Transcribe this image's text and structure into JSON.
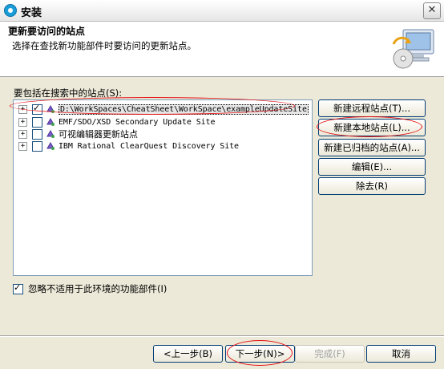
{
  "window": {
    "title": "安装"
  },
  "banner": {
    "title": "更新要访问的站点",
    "description": "选择在查找新功能部件时要访问的更新站点。"
  },
  "site_list": {
    "label": "要包括在搜索中的站点(S):",
    "items": [
      {
        "label": "D:\\WorkSpaces\\CheatSheet\\WorkSpace\\exampleUpdateSite",
        "checked": true
      },
      {
        "label": "EMF/SDO/XSD Secondary Update Site",
        "checked": false
      },
      {
        "label": "可视编辑器更新站点",
        "checked": false
      },
      {
        "label": "IBM Rational ClearQuest Discovery Site",
        "checked": false
      }
    ]
  },
  "side_buttons": {
    "new_remote": "新建远程站点(T)...",
    "new_local": "新建本地站点(L)...",
    "new_archived": "新建已归档的站点(A)...",
    "edit": "编辑(E)...",
    "remove": "除去(R)"
  },
  "options": {
    "ignore_features_label": "忽略不适用于此环境的功能部件(I)",
    "ignore_features_checked": true
  },
  "nav_buttons": {
    "back": "<上一步(B)",
    "next": "下一步(N)>",
    "finish": "完成(F)",
    "cancel": "取消"
  },
  "colors": {
    "annotation": "#e31010",
    "dialog_bg": "#ece9d8"
  }
}
